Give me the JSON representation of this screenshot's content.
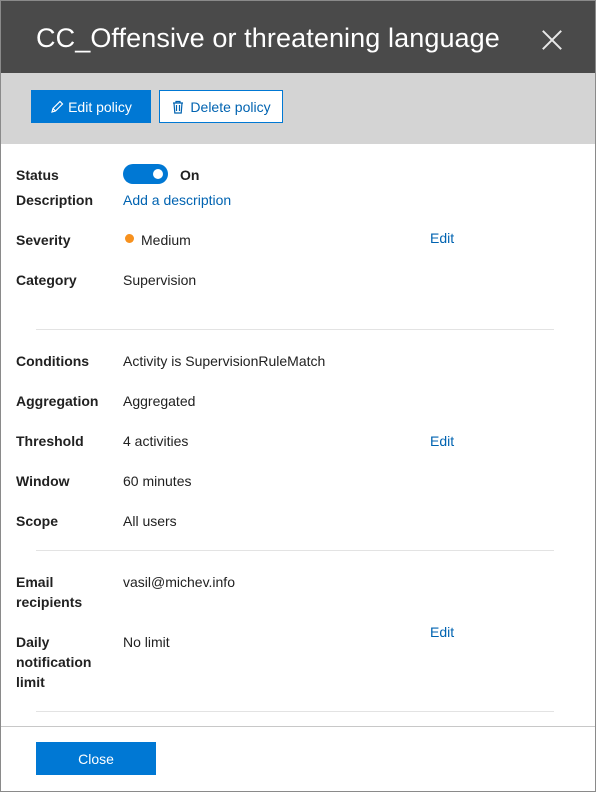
{
  "panel": {
    "title": "CC_Offensive or threatening language"
  },
  "toolbar": {
    "edit_label": "Edit policy",
    "delete_label": "Delete policy"
  },
  "details": {
    "status_label": "Status",
    "status_value": "On",
    "status_on": true,
    "description_label": "Description",
    "description_link": "Add a description",
    "severity_label": "Severity",
    "severity_value": "Medium",
    "severity_color": "#f7911e",
    "category_label": "Category",
    "category_value": "Supervision",
    "conditions_label": "Conditions",
    "conditions_value": "Activity is SupervisionRuleMatch",
    "aggregation_label": "Aggregation",
    "aggregation_value": "Aggregated",
    "threshold_label": "Threshold",
    "threshold_value": "4 activities",
    "window_label": "Window",
    "window_value": "60 minutes",
    "scope_label": "Scope",
    "scope_value": "All users",
    "email_label_line1": "Email",
    "email_label_line2": "recipients",
    "email_value": "vasil@michev.info",
    "daily_label_line1": "Daily",
    "daily_label_line2": "notification",
    "daily_label_line3": "limit",
    "daily_value": "No limit"
  },
  "edit_links": {
    "section1": "Edit",
    "section2": "Edit",
    "section3": "Edit"
  },
  "footer": {
    "close_label": "Close"
  },
  "colors": {
    "title_bar": "#4a4a4a",
    "toolbar": "#d4d4d4",
    "accent": "#0078d4",
    "link": "#0063b1"
  }
}
